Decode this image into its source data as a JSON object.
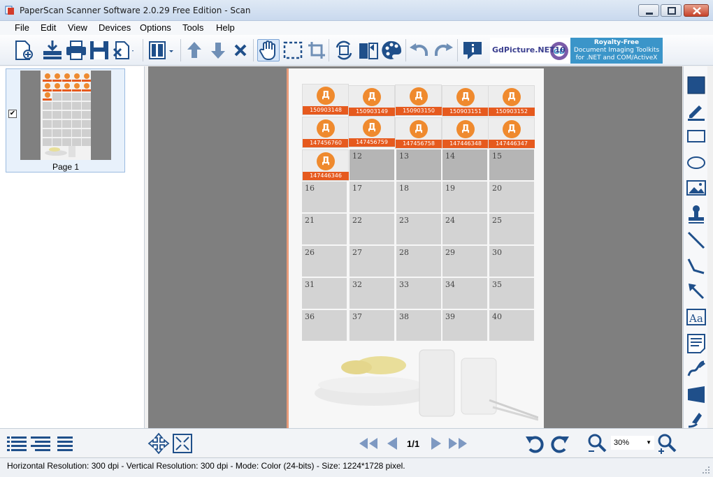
{
  "window": {
    "title": "PaperScan Scanner Software 2.0.29 Free Edition - Scan"
  },
  "menu": [
    "File",
    "Edit",
    "View",
    "Devices",
    "Options",
    "Tools",
    "Help"
  ],
  "banner": {
    "brand": "GdPicture.NET10",
    "line1": "Royalty-Free",
    "line2": "Document Imaging Toolkits",
    "line3": "for .NET and COM/ActiveX"
  },
  "thumbnails": {
    "items": [
      {
        "label": "Page 1",
        "checked": "✔"
      }
    ]
  },
  "document": {
    "stickers_row1": [
      {
        "letter": "Д",
        "code": "150903148"
      },
      {
        "letter": "Д",
        "code": "150903149"
      },
      {
        "letter": "Д",
        "code": "150903150"
      },
      {
        "letter": "Д",
        "code": "150903151"
      },
      {
        "letter": "Д",
        "code": "150903152"
      }
    ],
    "stickers_row2": [
      {
        "letter": "Д",
        "code": "147456760"
      },
      {
        "letter": "Д",
        "code": "147456759"
      },
      {
        "letter": "Д",
        "code": "147456758"
      },
      {
        "letter": "Д",
        "code": "147446348"
      },
      {
        "letter": "Д",
        "code": "147446347"
      }
    ],
    "stickers_row3": [
      {
        "letter": "Д",
        "code": "147446346"
      }
    ],
    "row3_numbers": [
      "12",
      "13",
      "14",
      "15"
    ],
    "grid_rows": [
      [
        "16",
        "17",
        "18",
        "19",
        "20"
      ],
      [
        "21",
        "22",
        "23",
        "24",
        "25"
      ],
      [
        "26",
        "27",
        "28",
        "29",
        "30"
      ],
      [
        "31",
        "32",
        "33",
        "34",
        "35"
      ],
      [
        "36",
        "37",
        "38",
        "39",
        "40"
      ]
    ]
  },
  "navigation": {
    "page_indicator": "1/1",
    "zoom": "30%"
  },
  "status": {
    "text": "Horizontal Resolution:  300 dpi - Vertical Resolution:  300 dpi - Mode: Color (24-bits) - Size: 1224*1728 pixel."
  },
  "colors": {
    "accent": "#1f5fa8",
    "sticker_orange": "#ef8a2e",
    "sticker_band": "#e65a1e"
  }
}
